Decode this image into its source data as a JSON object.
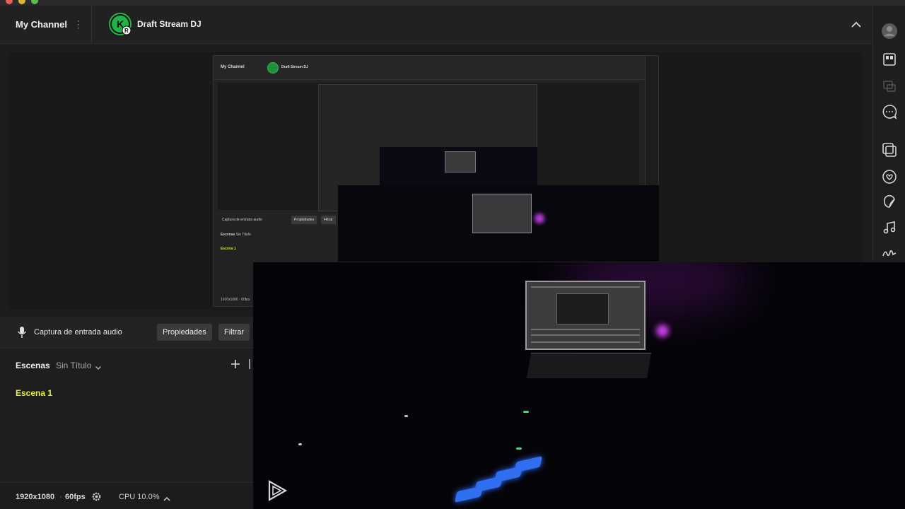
{
  "header": {
    "channel_title": "My Channel",
    "stream_name": "Draft Stream DJ",
    "logo_letter": "K",
    "logo_badge": "R"
  },
  "sidebar": {
    "icons": [
      "avatar-icon",
      "layout-icon",
      "multi-screen-icon",
      "chat-icon",
      "overlay-icon",
      "support-icon",
      "sticker-icon",
      "music-icon",
      "signature-icon"
    ]
  },
  "audio": {
    "source_label": "Captura de entrada audio",
    "properties_label": "Propiedades",
    "filter_label": "Filtrar"
  },
  "scenes": {
    "title": "Escenas",
    "collection": "Sin Título",
    "items": [
      {
        "label": "Escena 1"
      }
    ]
  },
  "footer": {
    "resolution": "1920x1080",
    "separator": "·",
    "fps": "60fps",
    "cpu": "CPU 10.0%"
  },
  "nested_preview": {
    "channel_title": "My Channel",
    "stream_name": "Draft Stream DJ",
    "source_label": "Captura de entrada audio",
    "properties_label": "Propiedades",
    "filter_label": "Filtrar",
    "scenes_title": "Escenas",
    "collection": "Sin Título",
    "scene": "Escena 1",
    "resolution": "1920x1080 · 60fps"
  },
  "colors": {
    "accent_scene": "#e5f03a",
    "logo_green": "#1f8f3a",
    "background": "#1d1d1d"
  }
}
